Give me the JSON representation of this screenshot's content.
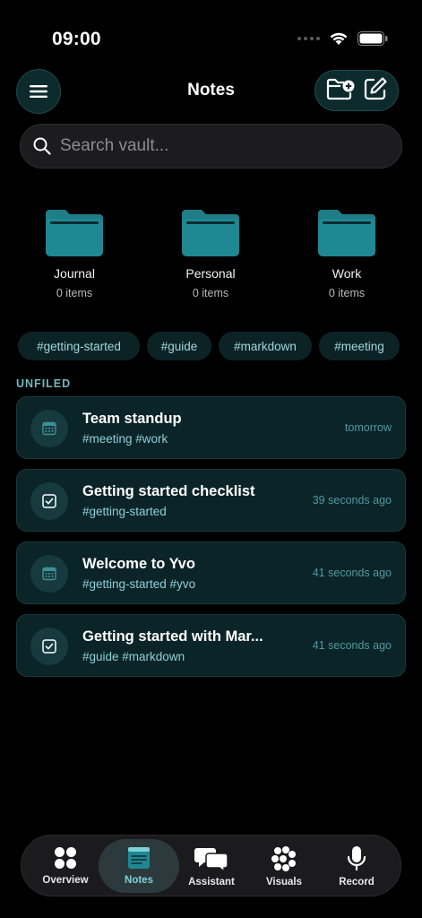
{
  "status_bar": {
    "time": "09:00"
  },
  "header": {
    "title": "Notes",
    "menu_icon": "hamburger-icon",
    "actions": [
      "new-folder-icon",
      "compose-icon"
    ]
  },
  "search": {
    "placeholder": "Search vault..."
  },
  "folders": [
    {
      "name": "Journal",
      "count": "0 items"
    },
    {
      "name": "Personal",
      "count": "0 items"
    },
    {
      "name": "Work",
      "count": "0 items"
    }
  ],
  "tags": [
    "#getting-started",
    "#guide",
    "#markdown",
    "#meeting"
  ],
  "section_label": "UNFILED",
  "notes": [
    {
      "title": "Team standup",
      "tags": "#meeting #work",
      "time": "tomorrow",
      "icon": "calendar-icon"
    },
    {
      "title": "Getting started checklist",
      "tags": "#getting-started",
      "time": "39 seconds ago",
      "icon": "checkbox-icon"
    },
    {
      "title": "Welcome to Yvo",
      "tags": "#getting-started #yvo",
      "time": "41 seconds ago",
      "icon": "calendar-icon"
    },
    {
      "title": "Getting started with Mar...",
      "tags": "#guide #markdown",
      "time": "41 seconds ago",
      "icon": "checkbox-icon"
    }
  ],
  "bottom_nav": [
    {
      "label": "Overview",
      "icon": "grid-icon"
    },
    {
      "label": "Notes",
      "icon": "notes-icon",
      "active": true
    },
    {
      "label": "Assistant",
      "icon": "chat-icon"
    },
    {
      "label": "Visuals",
      "icon": "dots-icon"
    },
    {
      "label": "Record",
      "icon": "microphone-icon"
    }
  ],
  "colors": {
    "accent": "#1f7f88",
    "card_bg": "#0b2427",
    "tag_text": "#8ed0d6",
    "background": "#000000"
  }
}
